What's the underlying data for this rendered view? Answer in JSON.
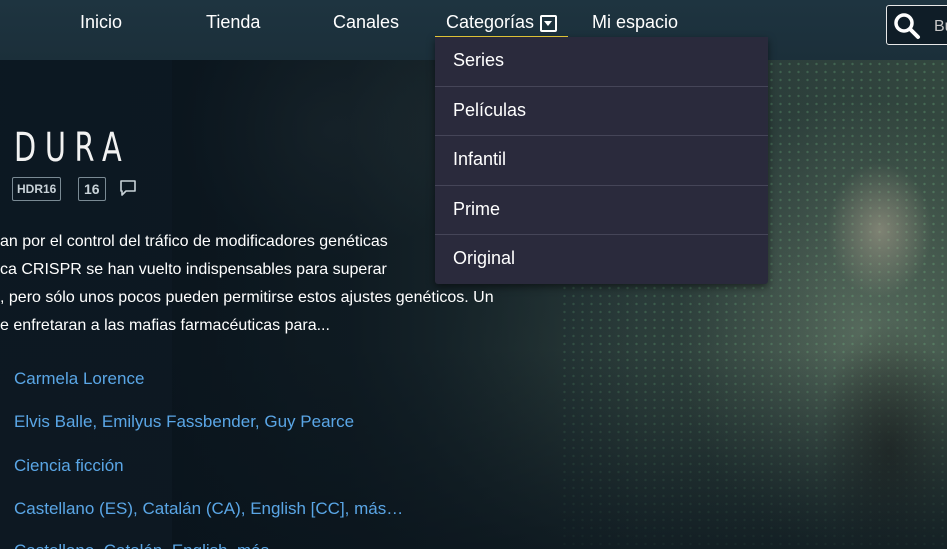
{
  "nav": {
    "items": [
      "Inicio",
      "Tienda",
      "Canales"
    ],
    "categories_label": "Categorías",
    "mi_espacio": "Mi espacio",
    "search_text": "Bu"
  },
  "dropdown": {
    "items": [
      "Series",
      "Películas",
      "Infantil",
      "Prime",
      "Original"
    ]
  },
  "show": {
    "title": "DURA",
    "badges": [
      "HDR16",
      "16"
    ],
    "synopsis_lines": [
      "an por el control del tráfico de modificadores genéticas",
      "ca CRISPR se han vuelto indispensables para superar",
      ", pero sólo unos pocos pueden permitirse estos ajustes genéticos. Un",
      "e enfretaran a las mafias farmacéuticas para..."
    ],
    "director": "Carmela Lorence",
    "cast": "Elvis Balle, Emilyus Fassbender, Guy Pearce",
    "genre": "Ciencia ficción",
    "audio": "Castellano (ES), Catalán (CA), English [CC], más…",
    "subtitles": "Castellano, Catalán, English, más…"
  },
  "colors": {
    "accent_underline": "#f2d53c",
    "link": "#5aa6e6",
    "dropdown_bg": "#2a2a3c",
    "navbar_bg": "#1e3440"
  },
  "icons": {
    "search": "search-icon",
    "categories_caret": "caret-down-box-icon",
    "comment": "comment-icon"
  }
}
